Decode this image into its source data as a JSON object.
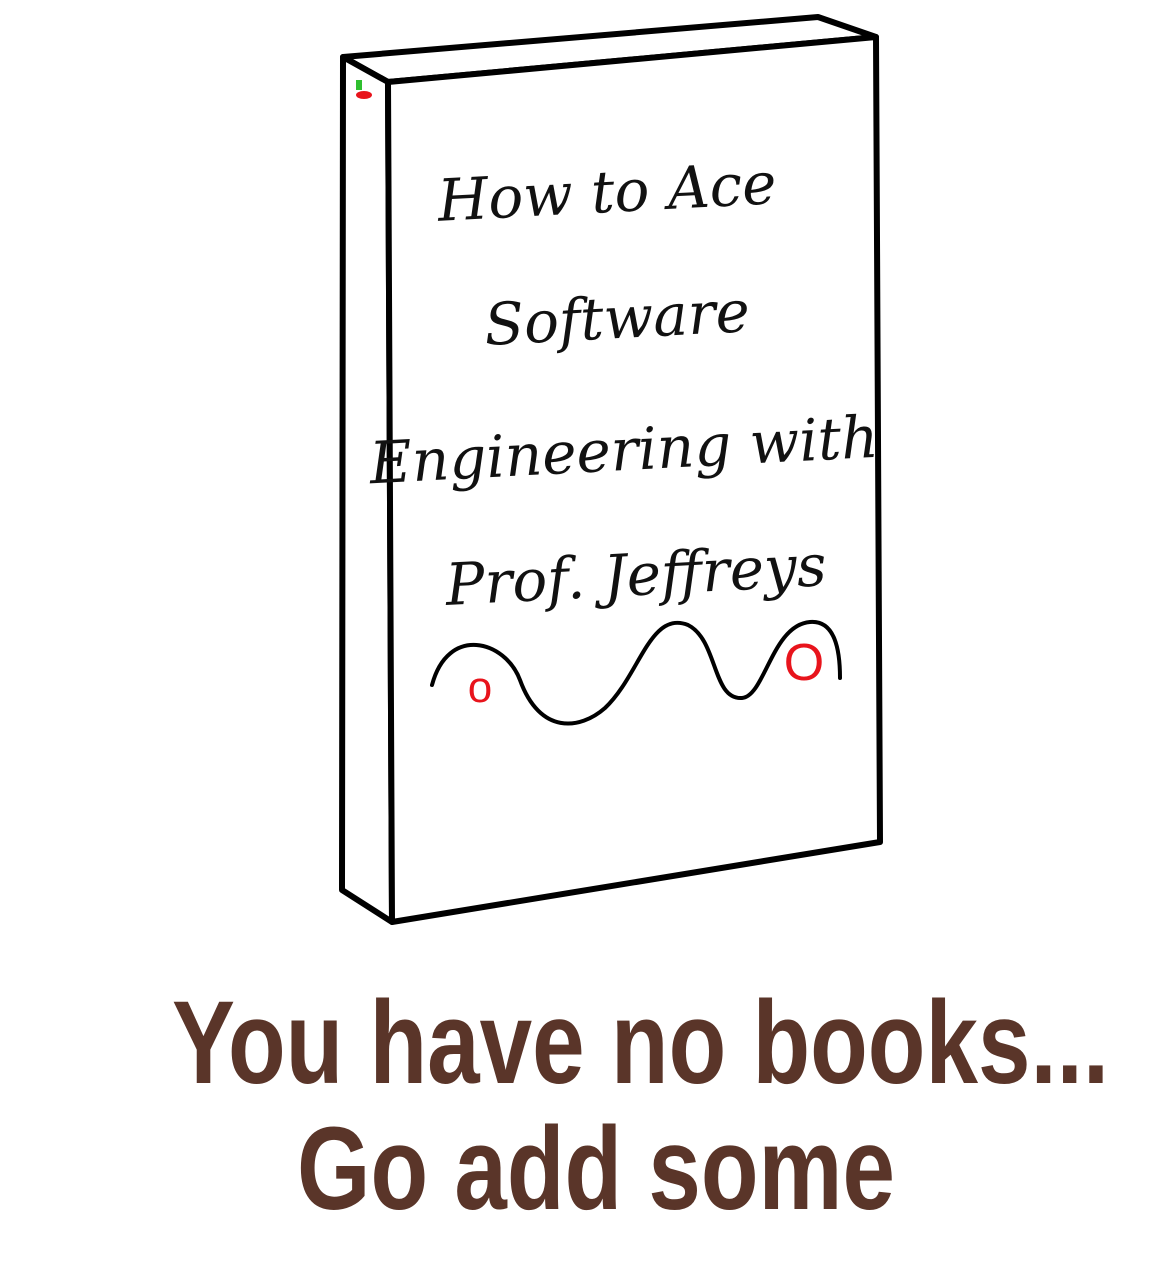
{
  "book": {
    "title_lines": [
      "How to Ace",
      "Software",
      "Engineering with",
      "Prof. Jeffreys"
    ],
    "logo": {
      "left_letter": "o",
      "right_letter": "O",
      "letter_color": "#e8141c"
    }
  },
  "empty_state": {
    "line1": "You have no books...",
    "line2": "Go add some",
    "text_color": "#5a3529"
  }
}
